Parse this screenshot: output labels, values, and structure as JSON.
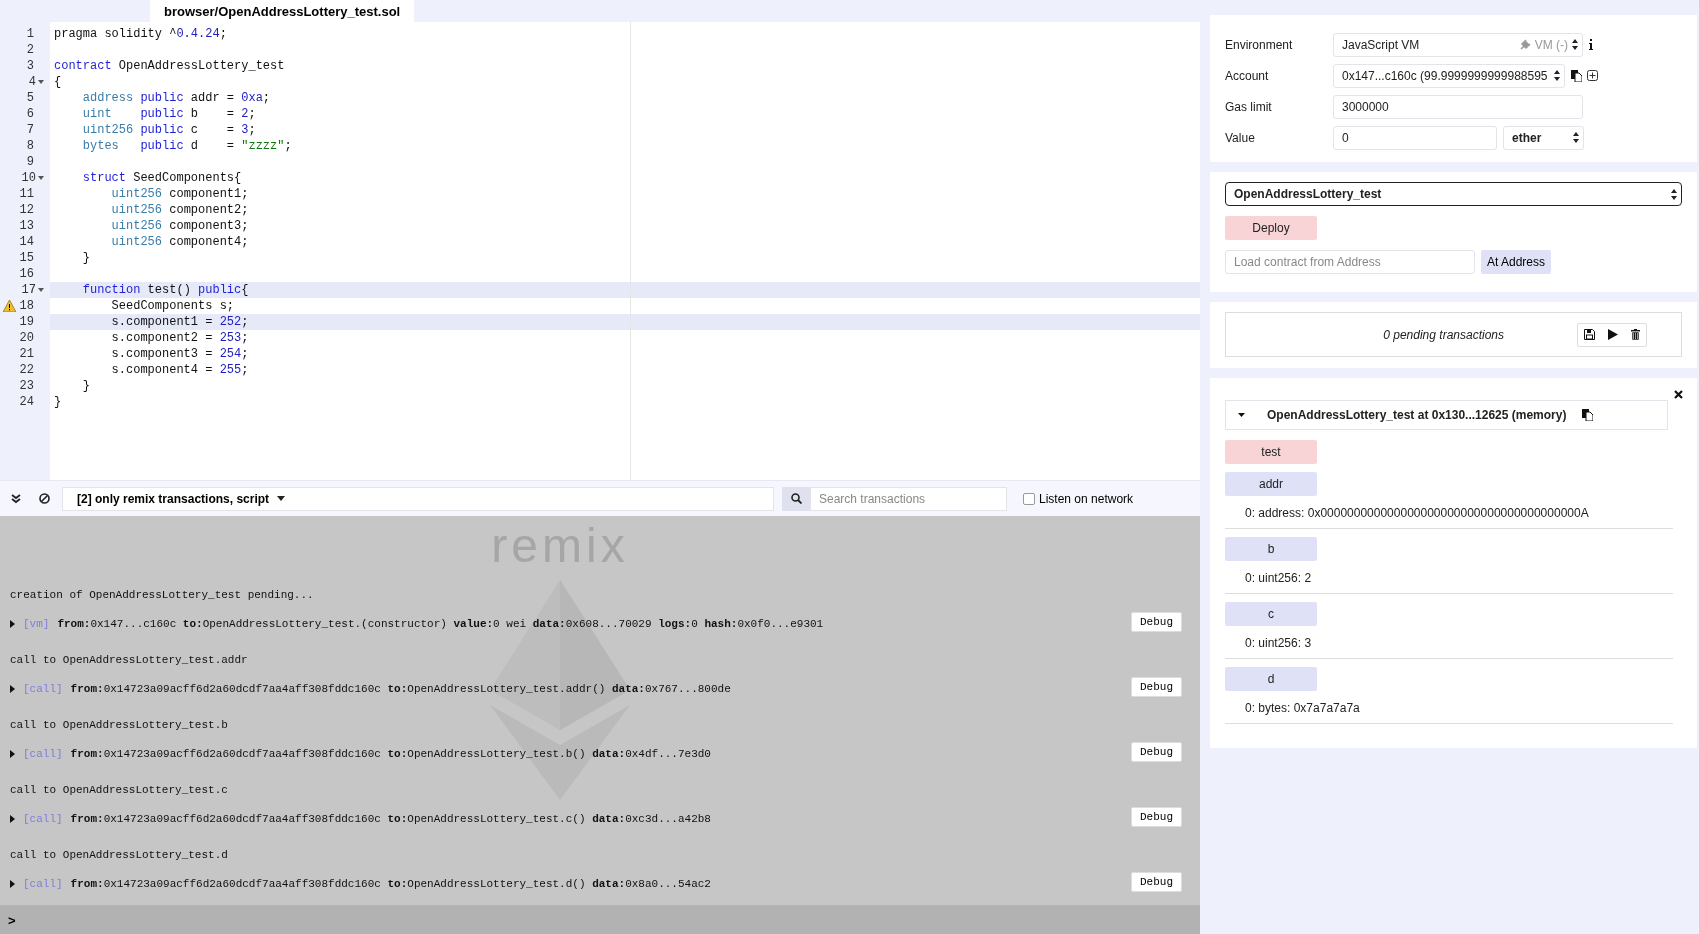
{
  "editor": {
    "tab": "browser/OpenAddressLottery_test.sol",
    "lines": [
      {
        "number": "1",
        "fold": false,
        "warning": false,
        "highlighted": false,
        "tokens": [
          {
            "kind": "plain",
            "text": "pragma solidity ^"
          },
          {
            "kind": "number",
            "text": "0.4.24"
          },
          {
            "kind": "plain",
            "text": ";"
          }
        ]
      },
      {
        "number": "2",
        "fold": false,
        "warning": false,
        "highlighted": false
      },
      {
        "number": "3",
        "fold": false,
        "warning": false,
        "highlighted": false,
        "tokens": [
          {
            "kind": "keyword",
            "text": "contract"
          },
          {
            "kind": "plain",
            "text": " OpenAddressLottery_test"
          }
        ]
      },
      {
        "number": "4",
        "fold": true,
        "warning": false,
        "highlighted": false,
        "tokens": [
          {
            "kind": "plain",
            "text": "{"
          }
        ]
      },
      {
        "number": "5",
        "fold": false,
        "warning": false,
        "highlighted": false,
        "tokens": [
          {
            "kind": "type",
            "text": "    address"
          },
          {
            "kind": "keyword",
            "text": " public"
          },
          {
            "kind": "plain",
            "text": " addr = "
          },
          {
            "kind": "number",
            "text": "0xa"
          },
          {
            "kind": "plain",
            "text": ";"
          }
        ]
      },
      {
        "number": "6",
        "fold": false,
        "warning": false,
        "highlighted": false,
        "tokens": [
          {
            "kind": "type",
            "text": "    uint   "
          },
          {
            "kind": "keyword",
            "text": " public"
          },
          {
            "kind": "plain",
            "text": " b    = "
          },
          {
            "kind": "number",
            "text": "2"
          },
          {
            "kind": "plain",
            "text": ";"
          }
        ]
      },
      {
        "number": "7",
        "fold": false,
        "warning": false,
        "highlighted": false,
        "tokens": [
          {
            "kind": "type",
            "text": "    uint256"
          },
          {
            "kind": "keyword",
            "text": " public"
          },
          {
            "kind": "plain",
            "text": " c    = "
          },
          {
            "kind": "number",
            "text": "3"
          },
          {
            "kind": "plain",
            "text": ";"
          }
        ]
      },
      {
        "number": "8",
        "fold": false,
        "warning": false,
        "highlighted": false,
        "tokens": [
          {
            "kind": "type",
            "text": "    bytes  "
          },
          {
            "kind": "keyword",
            "text": " public"
          },
          {
            "kind": "plain",
            "text": " d    = "
          },
          {
            "kind": "string",
            "text": "\"zzzz\""
          },
          {
            "kind": "plain",
            "text": ";"
          }
        ]
      },
      {
        "number": "9",
        "fold": false,
        "warning": false,
        "highlighted": false
      },
      {
        "number": "10",
        "fold": true,
        "warning": false,
        "highlighted": false,
        "tokens": [
          {
            "kind": "keyword",
            "text": "    struct"
          },
          {
            "kind": "plain",
            "text": " SeedComponents{"
          }
        ]
      },
      {
        "number": "11",
        "fold": false,
        "warning": false,
        "highlighted": false,
        "tokens": [
          {
            "kind": "type",
            "text": "        uint256"
          },
          {
            "kind": "plain",
            "text": " component1;"
          }
        ]
      },
      {
        "number": "12",
        "fold": false,
        "warning": false,
        "highlighted": false,
        "tokens": [
          {
            "kind": "type",
            "text": "        uint256"
          },
          {
            "kind": "plain",
            "text": " component2;"
          }
        ]
      },
      {
        "number": "13",
        "fold": false,
        "warning": false,
        "highlighted": false,
        "tokens": [
          {
            "kind": "type",
            "text": "        uint256"
          },
          {
            "kind": "plain",
            "text": " component3;"
          }
        ]
      },
      {
        "number": "14",
        "fold": false,
        "warning": false,
        "highlighted": false,
        "tokens": [
          {
            "kind": "type",
            "text": "        uint256"
          },
          {
            "kind": "plain",
            "text": " component4;"
          }
        ]
      },
      {
        "number": "15",
        "fold": false,
        "warning": false,
        "highlighted": false,
        "tokens": [
          {
            "kind": "plain",
            "text": "    }"
          }
        ]
      },
      {
        "number": "16",
        "fold": false,
        "warning": false,
        "highlighted": false
      },
      {
        "number": "17",
        "fold": true,
        "warning": false,
        "highlighted": true,
        "tokens": [
          {
            "kind": "keyword",
            "text": "    function"
          },
          {
            "kind": "plain",
            "text": " test() "
          },
          {
            "kind": "keyword",
            "text": "public"
          },
          {
            "kind": "plain",
            "text": "{"
          }
        ]
      },
      {
        "number": "18",
        "fold": false,
        "warning": true,
        "highlighted": false,
        "tokens": [
          {
            "kind": "plain",
            "text": "        SeedComponents s;"
          }
        ]
      },
      {
        "number": "19",
        "fold": false,
        "warning": false,
        "highlighted": true,
        "tokens": [
          {
            "kind": "plain",
            "text": "        s.component1 = "
          },
          {
            "kind": "number",
            "text": "252"
          },
          {
            "kind": "plain",
            "text": ";"
          }
        ]
      },
      {
        "number": "20",
        "fold": false,
        "warning": false,
        "highlighted": false,
        "tokens": [
          {
            "kind": "plain",
            "text": "        s.component2 = "
          },
          {
            "kind": "number",
            "text": "253"
          },
          {
            "kind": "plain",
            "text": ";"
          }
        ]
      },
      {
        "number": "21",
        "fold": false,
        "warning": false,
        "highlighted": false,
        "tokens": [
          {
            "kind": "plain",
            "text": "        s.component3 = "
          },
          {
            "kind": "number",
            "text": "254"
          },
          {
            "kind": "plain",
            "text": ";"
          }
        ]
      },
      {
        "number": "22",
        "fold": false,
        "warning": false,
        "highlighted": false,
        "tokens": [
          {
            "kind": "plain",
            "text": "        s.component4 = "
          },
          {
            "kind": "number",
            "text": "255"
          },
          {
            "kind": "plain",
            "text": ";"
          }
        ]
      },
      {
        "number": "23",
        "fold": false,
        "warning": false,
        "highlighted": false,
        "tokens": [
          {
            "kind": "plain",
            "text": "    }"
          }
        ]
      },
      {
        "number": "24",
        "fold": false,
        "warning": false,
        "highlighted": false,
        "tokens": [
          {
            "kind": "plain",
            "text": "}"
          }
        ]
      }
    ]
  },
  "console": {
    "filter": "[2] only remix transactions, script",
    "search": {
      "placeholder": "Search transactions"
    },
    "listen": {
      "label": "Listen on network",
      "checked": false
    },
    "background_text": "remix",
    "prompt": ">",
    "entries": [
      {
        "heading": "creation of OpenAddressLottery_test pending...",
        "tag": "[vm]",
        "detail": "**from:**0x147...c160c **to:**OpenAddressLottery_test.(constructor) **value:**0 wei **data:**0x608...70029 **logs:**0 **hash:**0x0f0...e9301",
        "button": "Debug"
      },
      {
        "heading": "call to OpenAddressLottery_test.addr",
        "tag": "[call]",
        "detail": "**from:**0x14723a09acff6d2a60dcdf7aa4aff308fddc160c **to:**OpenAddressLottery_test.addr() **data:**0x767...800de",
        "button": "Debug"
      },
      {
        "heading": "call to OpenAddressLottery_test.b",
        "tag": "[call]",
        "detail": "**from:**0x14723a09acff6d2a60dcdf7aa4aff308fddc160c **to:**OpenAddressLottery_test.b() **data:**0x4df...7e3d0",
        "button": "Debug"
      },
      {
        "heading": "call to OpenAddressLottery_test.c",
        "tag": "[call]",
        "detail": "**from:**0x14723a09acff6d2a60dcdf7aa4aff308fddc160c **to:**OpenAddressLottery_test.c() **data:**0xc3d...a42b8",
        "button": "Debug"
      },
      {
        "heading": "call to OpenAddressLottery_test.d",
        "tag": "[call]",
        "detail": "**from:**0x14723a09acff6d2a60dcdf7aa4aff308fddc160c **to:**OpenAddressLottery_test.d() **data:**0x8a0...54ac2",
        "button": "Debug"
      }
    ]
  },
  "run": {
    "environment": {
      "label": "Environment",
      "value": "JavaScript VM",
      "note": "VM (-)"
    },
    "account": {
      "label": "Account",
      "value": "0x147...c160c (99.9999999999988595"
    },
    "gas_limit": {
      "label": "Gas limit",
      "value": "3000000"
    },
    "value": {
      "label": "Value",
      "value": "0",
      "unit": "ether"
    },
    "contract": "OpenAddressLottery_test",
    "deploy": "Deploy",
    "load": {
      "placeholder": "Load contract from Address",
      "button": "At Address"
    },
    "pending": "0 pending transactions",
    "instance": {
      "title": "OpenAddressLottery_test at 0x130...12625 (memory)",
      "expanded": true,
      "functions": [
        {
          "name": "test",
          "kind": "transact"
        },
        {
          "name": "addr",
          "kind": "call",
          "result": "0: address: 0x000000000000000000000000000000000000000A"
        },
        {
          "name": "b",
          "kind": "call",
          "result": "0: uint256: 2"
        },
        {
          "name": "c",
          "kind": "call",
          "result": "0: uint256: 3"
        },
        {
          "name": "d",
          "kind": "call",
          "result": "0: bytes: 0x7a7a7a7a"
        }
      ]
    }
  }
}
